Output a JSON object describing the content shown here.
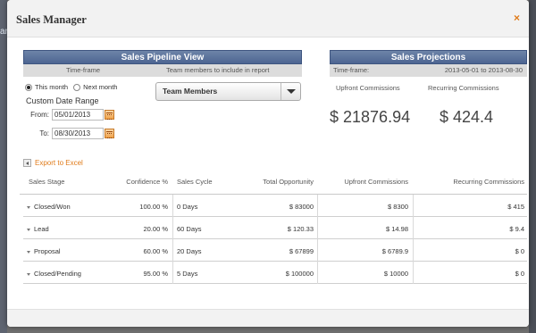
{
  "dialog": {
    "title": "Sales Manager",
    "close_glyph": "×"
  },
  "backdrop": {
    "peek_text": "ar"
  },
  "pipeline": {
    "heading": "Sales Pipeline View",
    "timeframe_label": "Time-frame",
    "team_label": "Team members to include in report",
    "radio_this_month": "This month",
    "radio_next_month": "Next month",
    "selected_timeframe": "This month",
    "custom_range_label": "Custom Date Range",
    "from_label": "From:",
    "from_value": "05/01/2013",
    "to_label": "To:",
    "to_value": "08/30/2013",
    "team_select_value": "Team Members"
  },
  "projections": {
    "heading": "Sales Projections",
    "timeframe_label": "Time-frame:",
    "range_value": "2013-05-01 to 2013-08-30",
    "upfront_label": "Upfront Commissions",
    "recurring_label": "Recurring Commissions",
    "upfront_amount": "$ 21876.94",
    "recurring_amount": "$ 424.4"
  },
  "export_label": "Export to Excel",
  "table": {
    "headers": [
      "Sales Stage",
      "Confidence %",
      "Sales Cycle",
      "Total Opportunity",
      "Upfront Commissions",
      "Recurring Commissions"
    ],
    "rows": [
      {
        "stage": "Closed/Won",
        "confidence": "100.00 %",
        "cycle": "0 Days",
        "total": "$ 83000",
        "upfront": "$ 8300",
        "recurring": "$ 415"
      },
      {
        "stage": "Lead",
        "confidence": "20.00 %",
        "cycle": "60 Days",
        "total": "$ 120.33",
        "upfront": "$ 14.98",
        "recurring": "$ 9.4"
      },
      {
        "stage": "Proposal",
        "confidence": "60.00 %",
        "cycle": "20 Days",
        "total": "$ 67899",
        "upfront": "$ 6789.9",
        "recurring": "$ 0"
      },
      {
        "stage": "Closed/Pending",
        "confidence": "95.00 %",
        "cycle": "5 Days",
        "total": "$ 100000",
        "upfront": "$ 10000",
        "recurring": "$ 0"
      }
    ]
  },
  "colors": {
    "accent": "#e07b1a",
    "panel_header": "#5a7098",
    "subheader": "#dcdcdc"
  }
}
